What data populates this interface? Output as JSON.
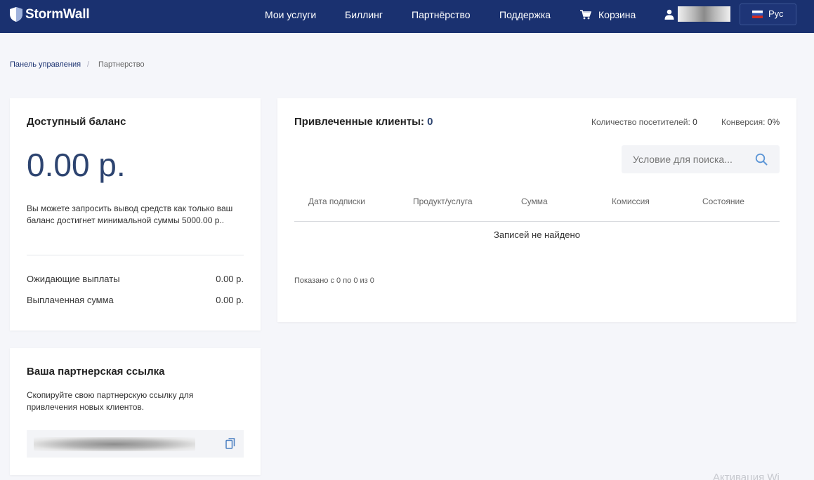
{
  "header": {
    "logo_text": "StormWall",
    "nav": [
      {
        "label": "Мои услуги"
      },
      {
        "label": "Биллинг"
      },
      {
        "label": "Партнёрство"
      },
      {
        "label": "Поддержка"
      },
      {
        "label": "Корзина"
      }
    ],
    "language": "Рус",
    "colors": {
      "bar": "#1a3170",
      "accent": "#2d4470"
    }
  },
  "breadcrumb": {
    "items": [
      "Панель управления",
      "Партнерство"
    ],
    "separator": "/"
  },
  "balance_card": {
    "title": "Доступный баланс",
    "amount": "0.00 р.",
    "note": "Вы можете запросить вывод средств как только ваш баланс достигнет минимальной суммы 5000.00 р..",
    "rows": [
      {
        "label": "Ожидающие выплаты",
        "value": "0.00 р."
      },
      {
        "label": "Выплаченная сумма",
        "value": "0.00 р."
      }
    ]
  },
  "link_card": {
    "title": "Ваша партнерская ссылка",
    "note": "Скопируйте свою партнерскую ссылку для привлечения новых клиентов."
  },
  "clients_card": {
    "title": "Привлеченные клиенты:",
    "count": "0",
    "visitors_label": "Количество посетителей:",
    "visitors_value": "0",
    "conversion_label": "Конверсия:",
    "conversion_value": "0%",
    "search_placeholder": "Условие для поиска...",
    "columns": [
      "Дата подписки",
      "Продукт/услуга",
      "Сумма",
      "Комиссия",
      "Состояние"
    ],
    "empty_message": "Записей не найдено",
    "pagination": "Показано с 0 по 0 из 0"
  },
  "watermark": "Активация Wi"
}
